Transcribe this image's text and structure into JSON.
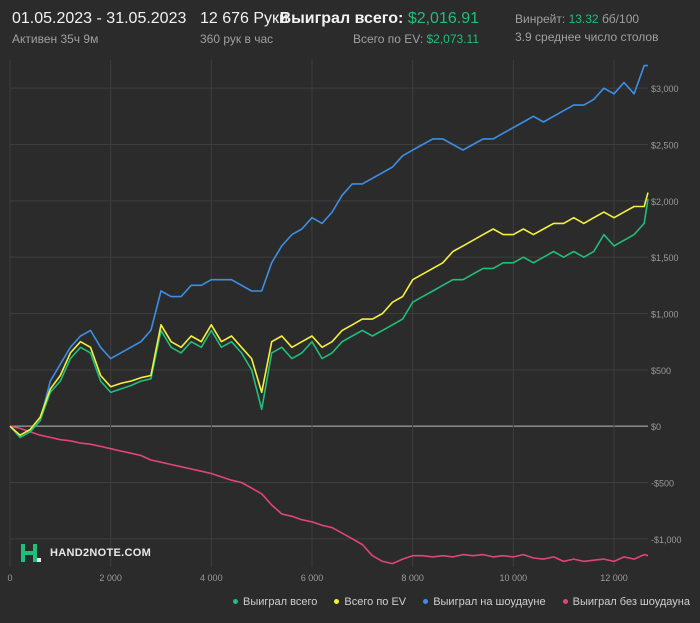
{
  "header": {
    "date_range": "01.05.2023 - 31.05.2023",
    "active": "Активен 35ч 9м",
    "hands": "12 676 Руки",
    "hands_per_hour": "360 рук в час",
    "won_total_label": "Выиграл всего:",
    "won_total_value": "$2,016.91",
    "ev_total_label": "Всего по EV:",
    "ev_total_value": "$2,073.11",
    "winrate_label": "Винрейт:",
    "winrate_value": "13.32",
    "winrate_unit": "бб/100",
    "avg_tables": "3.9 среднее число столов"
  },
  "logo": {
    "text": "HAND2NOTE.COM"
  },
  "colors": {
    "background": "#2b2b2b",
    "grid": "#3e3e3e",
    "zero_line": "#bcbcbc",
    "axis_text": "#9a9a9a",
    "won": "#1fbf7a",
    "ev": "#f5f03c",
    "showdown": "#3c8fe6",
    "non_showdown": "#e0457a"
  },
  "chart_data": {
    "type": "line",
    "xlabel": "",
    "ylabel": "",
    "xlim": [
      0,
      12676
    ],
    "ylim": [
      -1250,
      3250
    ],
    "x_ticks": [
      0,
      2000,
      4000,
      6000,
      8000,
      10000,
      12000
    ],
    "x_tick_labels": [
      "0",
      "2 000",
      "4 000",
      "6 000",
      "8 000",
      "10 000",
      "12 000"
    ],
    "y_ticks": [
      -1000,
      -500,
      0,
      500,
      1000,
      1500,
      2000,
      2500,
      3000
    ],
    "y_tick_labels": [
      "-$1,000",
      "-$500",
      "$0",
      "$500",
      "$1,000",
      "$1,500",
      "$2,000",
      "$2,500",
      "$3,000"
    ],
    "grid": true,
    "legend_position": "bottom",
    "x": [
      0,
      200,
      400,
      600,
      800,
      1000,
      1200,
      1400,
      1600,
      1800,
      2000,
      2200,
      2400,
      2600,
      2800,
      3000,
      3200,
      3400,
      3600,
      3800,
      4000,
      4200,
      4400,
      4600,
      4800,
      5000,
      5200,
      5400,
      5600,
      5800,
      6000,
      6200,
      6400,
      6600,
      6800,
      7000,
      7200,
      7400,
      7600,
      7800,
      8000,
      8200,
      8400,
      8600,
      8800,
      9000,
      9200,
      9400,
      9600,
      9800,
      10000,
      10200,
      10400,
      10600,
      10800,
      11000,
      11200,
      11400,
      11600,
      11800,
      12000,
      12200,
      12400,
      12600,
      12676
    ],
    "series": [
      {
        "name": "Выиграл всего",
        "color": "#1fbf7a",
        "values": [
          0,
          -100,
          -50,
          50,
          300,
          400,
          600,
          700,
          650,
          400,
          300,
          330,
          360,
          400,
          420,
          850,
          700,
          650,
          750,
          700,
          850,
          700,
          750,
          650,
          500,
          150,
          650,
          700,
          600,
          650,
          750,
          600,
          650,
          750,
          800,
          850,
          800,
          850,
          900,
          950,
          1100,
          1150,
          1200,
          1250,
          1300,
          1300,
          1350,
          1400,
          1400,
          1450,
          1450,
          1500,
          1450,
          1500,
          1550,
          1500,
          1550,
          1500,
          1550,
          1700,
          1600,
          1650,
          1700,
          1800,
          2016.91
        ]
      },
      {
        "name": "Всего по EV",
        "color": "#f5f03c",
        "values": [
          0,
          -80,
          -30,
          80,
          330,
          450,
          650,
          750,
          700,
          450,
          350,
          380,
          400,
          430,
          450,
          900,
          750,
          700,
          800,
          750,
          900,
          750,
          800,
          700,
          600,
          300,
          750,
          800,
          700,
          750,
          800,
          700,
          750,
          850,
          900,
          950,
          950,
          1000,
          1100,
          1150,
          1300,
          1350,
          1400,
          1450,
          1550,
          1600,
          1650,
          1700,
          1750,
          1700,
          1700,
          1750,
          1700,
          1750,
          1800,
          1800,
          1850,
          1800,
          1850,
          1900,
          1850,
          1900,
          1950,
          1950,
          2073.11
        ]
      },
      {
        "name": "Выиграл на шоудауне",
        "color": "#3c8fe6",
        "values": [
          0,
          -100,
          -50,
          50,
          400,
          550,
          700,
          800,
          850,
          700,
          600,
          650,
          700,
          750,
          850,
          1200,
          1150,
          1150,
          1250,
          1250,
          1300,
          1300,
          1300,
          1250,
          1200,
          1200,
          1450,
          1600,
          1700,
          1750,
          1850,
          1800,
          1900,
          2050,
          2150,
          2150,
          2200,
          2250,
          2300,
          2400,
          2450,
          2500,
          2550,
          2550,
          2500,
          2450,
          2500,
          2550,
          2550,
          2600,
          2650,
          2700,
          2750,
          2700,
          2750,
          2800,
          2850,
          2850,
          2900,
          3000,
          2950,
          3050,
          2950,
          3200,
          3200
        ]
      },
      {
        "name": "Выиграл без шоудауна",
        "color": "#e0457a",
        "values": [
          0,
          -20,
          -50,
          -80,
          -100,
          -120,
          -130,
          -150,
          -160,
          -180,
          -200,
          -220,
          -240,
          -260,
          -300,
          -320,
          -340,
          -360,
          -380,
          -400,
          -420,
          -450,
          -480,
          -500,
          -550,
          -600,
          -700,
          -780,
          -800,
          -830,
          -850,
          -880,
          -900,
          -950,
          -1000,
          -1050,
          -1150,
          -1200,
          -1220,
          -1180,
          -1150,
          -1150,
          -1160,
          -1150,
          -1160,
          -1140,
          -1150,
          -1140,
          -1160,
          -1150,
          -1160,
          -1140,
          -1170,
          -1180,
          -1160,
          -1200,
          -1180,
          -1200,
          -1190,
          -1180,
          -1200,
          -1160,
          -1180,
          -1140,
          -1150
        ]
      }
    ]
  },
  "legend": [
    {
      "label": "Выиграл всего",
      "color": "#1fbf7a"
    },
    {
      "label": "Всего по EV",
      "color": "#f5f03c"
    },
    {
      "label": "Выиграл на шоудауне",
      "color": "#3c8fe6"
    },
    {
      "label": "Выиграл без шоудауна",
      "color": "#e0457a"
    }
  ]
}
